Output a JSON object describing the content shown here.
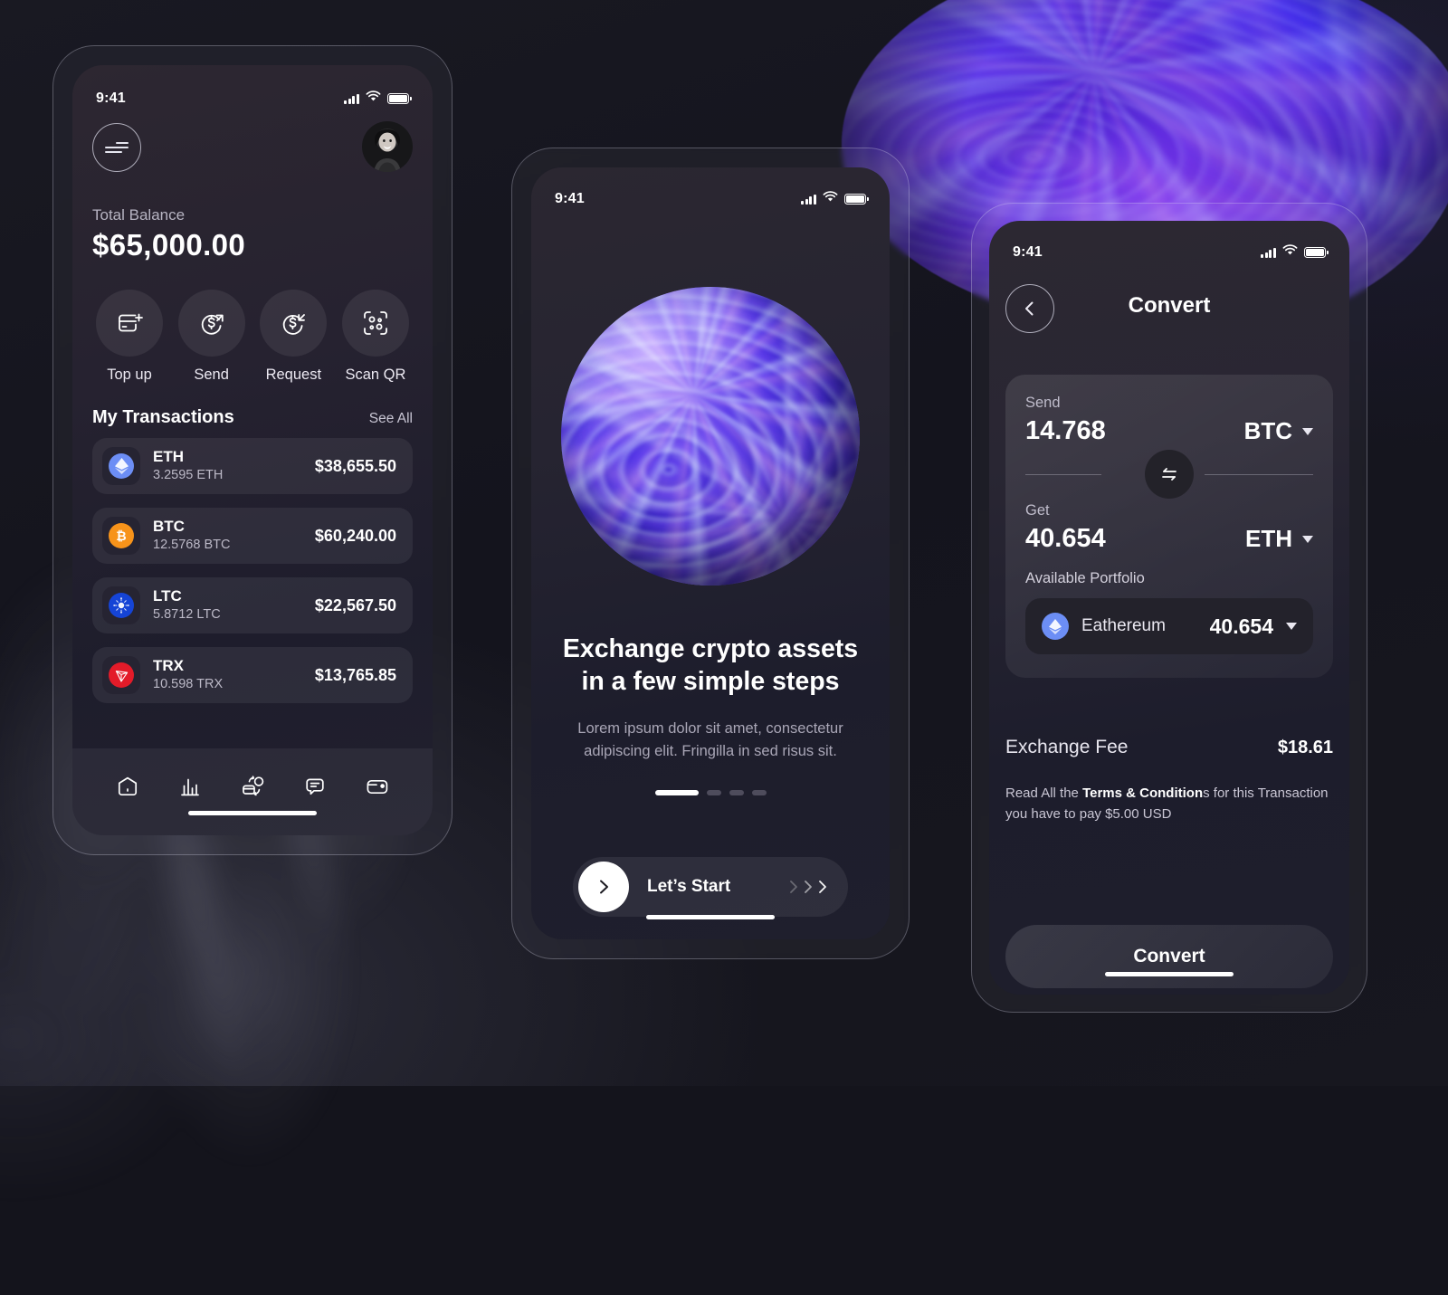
{
  "meta": {
    "status_time": "9:41"
  },
  "wallet": {
    "menu_icon": "hamburger-menu-icon",
    "avatar_alt": "user-avatar",
    "balance_label": "Total Balance",
    "balance_amount": "$65,000.00",
    "actions": [
      {
        "label": "Top up",
        "icon": "card-plus-icon"
      },
      {
        "label": "Send",
        "icon": "dollar-arrow-up-right-icon"
      },
      {
        "label": "Request",
        "icon": "dollar-arrow-down-left-icon"
      },
      {
        "label": "Scan QR",
        "icon": "qr-scan-icon"
      }
    ],
    "section_title": "My Transactions",
    "see_all": "See All",
    "transactions": [
      {
        "symbol": "ETH",
        "amount": "3.2595  ETH",
        "usd": "$38,655.50",
        "color": "#6c8ef5",
        "glyph": "eth"
      },
      {
        "symbol": "BTC",
        "amount": "12.5768  BTC",
        "usd": "$60,240.00",
        "color": "#f7931a",
        "glyph": "btc"
      },
      {
        "symbol": "LTC",
        "amount": "5.8712  LTC",
        "usd": "$22,567.50",
        "color": "#1544d6",
        "glyph": "ada"
      },
      {
        "symbol": "TRX",
        "amount": "10.598  TRX",
        "usd": "$13,765.85",
        "color": "#e31b29",
        "glyph": "trx"
      }
    ],
    "tabs": [
      {
        "name": "home-icon"
      },
      {
        "name": "stats-bar-chart-icon"
      },
      {
        "name": "card-swap-icon"
      },
      {
        "name": "chat-bubble-icon"
      },
      {
        "name": "wallet-icon"
      }
    ]
  },
  "onboarding": {
    "hero_line1": "Exchange crypto assets",
    "hero_line2": "in a few simple steps",
    "subtitle_line1": "Lorem ipsum dolor sit amet, consectetur",
    "subtitle_line2": "adipiscing elit. Fringilla in sed risus sit.",
    "dots_total": 4,
    "dots_active_index": 0,
    "cta_label": "Let’s Start",
    "cta_icon": "chevron-right-icon"
  },
  "convert": {
    "back_icon": "chevron-left-icon",
    "title": "Convert",
    "send_label": "Send",
    "send_value": "14.768",
    "send_currency": "BTC",
    "swap_icon": "swap-arrows-icon",
    "get_label": "Get",
    "get_value": "40.654",
    "get_currency": "ETH",
    "portfolio_label": "Available Portfolio",
    "portfolio_item": {
      "name": "Eathereum",
      "value": "40.654",
      "color": "#6c8ef5"
    },
    "fee_label": "Exchange Fee",
    "fee_value": "$18.61",
    "terms_prefix": "Read All the ",
    "terms_bold": "Terms & Condition",
    "terms_suffix": "s for this Transaction you have to pay $5.00 USD",
    "cta_label": "Convert"
  },
  "colors": {
    "page_bg": "#16161f",
    "screen_bg": "#262130",
    "accent_white": "#ffffff",
    "muted_text": "#b7b4c2"
  }
}
